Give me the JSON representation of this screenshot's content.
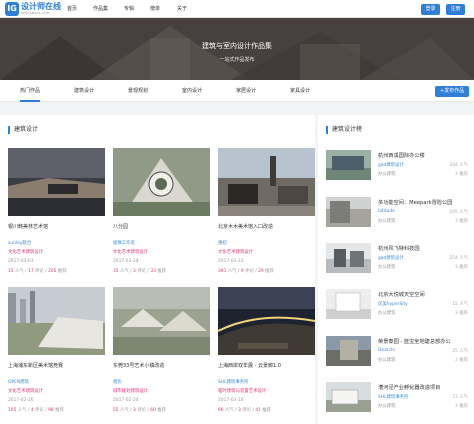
{
  "header": {
    "logo_mark": "IG",
    "logo_title": "设计师在线",
    "logo_sub": "SPSCABGOL.COM",
    "nav": [
      "首页",
      "作品集",
      "专辑",
      "榜单",
      "关于"
    ],
    "login": "登录",
    "register": "注册"
  },
  "banner": {
    "title": "建筑与室内设计作品集",
    "subtitle": "一站式作品发布"
  },
  "tabs": [
    "热门作品",
    "建筑设计",
    "景观规划",
    "室内设计",
    "家居设计",
    "家具设计"
  ],
  "publish_button": "+发布作品",
  "left": {
    "title": "建筑设计",
    "cards": [
      {
        "title": "银川韩美林艺术馆",
        "author": "sunlay联合",
        "category": "文化艺术建筑设计",
        "date": "2017-03-03",
        "stats_views": "15",
        "stats_text1": " 人气 / ",
        "stats_comments": "17",
        "stats_text2": " 评论 / ",
        "stats_likes": "205",
        "stats_text3": " 推荐"
      },
      {
        "title": "八分园",
        "author": "极致工作室",
        "category": "文化艺术建筑设计",
        "date": "2017-03-24",
        "stats_views": "35",
        "stats_text1": " 人气 / ",
        "stats_comments": "3",
        "stats_text2": " 评论 / ",
        "stats_likes": "33",
        "stats_text3": " 推荐"
      },
      {
        "title": "北京木木美术馆入口改造",
        "author": "重初",
        "category": "文化艺术建筑设计",
        "date": "2017-03-13",
        "stats_views": "391",
        "stats_text1": " 人气 / ",
        "stats_comments": "9",
        "stats_text2": " 评论 / ",
        "stats_likes": "29",
        "stats_text3": " 推荐"
      },
      {
        "title": "上海浦东新区美术馆竞赛",
        "author": "OPEN建筑",
        "category": "文化艺术建筑设计",
        "date": "2017-02-26",
        "stats_views": "105",
        "stats_text1": " 人气 / ",
        "stats_comments": "4",
        "stats_text2": " 评论 / ",
        "stats_likes": "98",
        "stats_text3": " 推荐"
      },
      {
        "title": "东莞33号艺术小镇改造",
        "author": "相优",
        "category": "城市规划建筑设计",
        "date": "2017-02-24",
        "stats_views": "55",
        "stats_text1": " 人气 / ",
        "stats_comments": "3",
        "stats_text2": " 评论 / ",
        "stats_likes": "60",
        "stats_text3": " 推荐"
      },
      {
        "title": "上海西岸双年展 - 云景廊1.0",
        "author": "SHL建筑事务所",
        "category": "临时建筑与装置艺术设计",
        "date": "2017-03-16",
        "stats_views": "66",
        "stats_text1": " 人气 / ",
        "stats_comments": "3",
        "stats_text2": " 评论 / ",
        "stats_likes": "41",
        "stats_text3": " 推荐"
      }
    ]
  },
  "right": {
    "title": "建筑设计榜",
    "items": [
      {
        "title": "杭州西溪国际办公楼",
        "author": "gad建筑设计",
        "category": "办公建筑",
        "views": "204 人气",
        "likes": "3 推荐"
      },
      {
        "title": "多功能空间：Meepark冒险公园",
        "author": "latitude",
        "category": "办公建筑",
        "views": "105 人气",
        "likes": "3 推荐"
      },
      {
        "title": "杭州风飞特科技园",
        "author": "gad建筑设计",
        "category": "办公建筑",
        "views": "254 人气",
        "likes": "3 推荐"
      },
      {
        "title": "北京大悦城天空空间",
        "author": "优美hyperSity",
        "category": "办公建筑",
        "views": "15 人气",
        "likes": "3 推荐"
      },
      {
        "title": "荣景泰园 - 蓝宝坐地建总部办公",
        "author": "Doarchi",
        "category": "办公建筑",
        "views": "25 人气",
        "likes": "3 推荐"
      },
      {
        "title": "漕河泾产业孵化器改造项目",
        "author": "SHL建筑事务所",
        "category": "办公建筑",
        "views": "73 人气",
        "likes": "3 推荐"
      }
    ]
  },
  "colors": {
    "accent": "#2f7fd6",
    "pink": "#e2347a",
    "link": "#3c8ad8"
  },
  "icons": [
    "logo-icon"
  ]
}
